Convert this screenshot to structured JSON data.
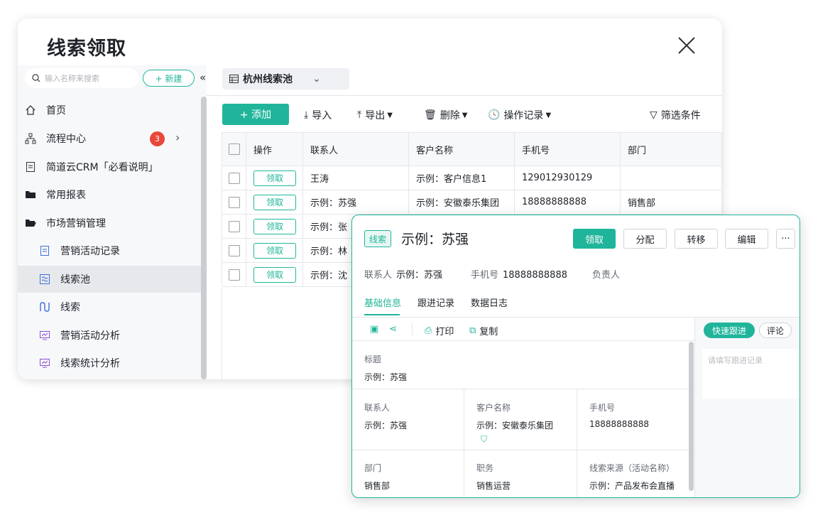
{
  "window": {
    "title": "线索领取"
  },
  "sidebar": {
    "search_placeholder": "输入名称来搜索",
    "new_label": "+ 新建",
    "collapse_label": "«",
    "items": [
      {
        "label": "首页",
        "icon": "home-icon"
      },
      {
        "label": "流程中心",
        "icon": "flow-icon",
        "badge": "3"
      },
      {
        "label": "简道云CRM「必看说明」",
        "icon": "doc-icon"
      },
      {
        "label": "常用报表",
        "icon": "folder-icon"
      },
      {
        "label": "市场营销管理",
        "icon": "folder-icon"
      },
      {
        "label": "营销活动记录",
        "icon": "form-icon"
      },
      {
        "label": "线索池",
        "icon": "pool-icon"
      },
      {
        "label": "线索",
        "icon": "lead-icon"
      },
      {
        "label": "营销活动分析",
        "icon": "chart-icon"
      },
      {
        "label": "线索统计分析",
        "icon": "chart-icon"
      }
    ]
  },
  "content": {
    "pool_tab": "杭州线索池",
    "toolbar": {
      "add": "+ 添加",
      "import": "导入",
      "export": "导出",
      "delete": "删除",
      "history": "操作记录",
      "filter": "筛选条件"
    },
    "table": {
      "columns": [
        "操作",
        "联系人",
        "客户名称",
        "手机号",
        "部门"
      ],
      "claim_label": "领取",
      "rows": [
        {
          "contact": "王涛",
          "customer": "示例：客户信息1",
          "phone": "129012930129",
          "dept": ""
        },
        {
          "contact": "示例：苏强",
          "customer": "示例：安徽泰乐集团",
          "phone": "18888888888",
          "dept": "销售部"
        },
        {
          "contact": "示例：张",
          "customer": "",
          "phone": "",
          "dept": ""
        },
        {
          "contact": "示例：林",
          "customer": "",
          "phone": "",
          "dept": ""
        },
        {
          "contact": "示例：沈",
          "customer": "",
          "phone": "",
          "dept": ""
        }
      ]
    }
  },
  "panel": {
    "tag": "线索",
    "title": "示例：苏强",
    "buttons": {
      "claim": "领取",
      "assign": "分配",
      "transfer": "转移",
      "edit": "编辑",
      "more": "···"
    },
    "meta": {
      "contact_label": "联系人",
      "contact_value": "示例：苏强",
      "phone_label": "手机号",
      "phone_value": "18888888888",
      "owner_label": "负责人"
    },
    "tabs": [
      "基础信息",
      "跟进记录",
      "数据日志"
    ],
    "tools": {
      "print": "打印",
      "copy": "复制"
    },
    "quick_follow": "快速跟进",
    "comment": "评论",
    "note_placeholder": "请填写跟进记录",
    "fields": {
      "title_label": "标题",
      "title_value": "示例：苏强",
      "contact_label": "联系人",
      "contact_value": "示例：苏强",
      "customer_label": "客户名称",
      "customer_value": "示例：安徽泰乐集团",
      "phone_label": "手机号",
      "phone_value": "18888888888",
      "dept_label": "部门",
      "dept_value": "销售部",
      "role_label": "职务",
      "role_value": "销售运营",
      "source_label": "线索来源（活动名称）",
      "source_value": "示例：产品发布会直播"
    }
  },
  "colors": {
    "accent": "#20b59b",
    "badge": "#e8473a"
  }
}
